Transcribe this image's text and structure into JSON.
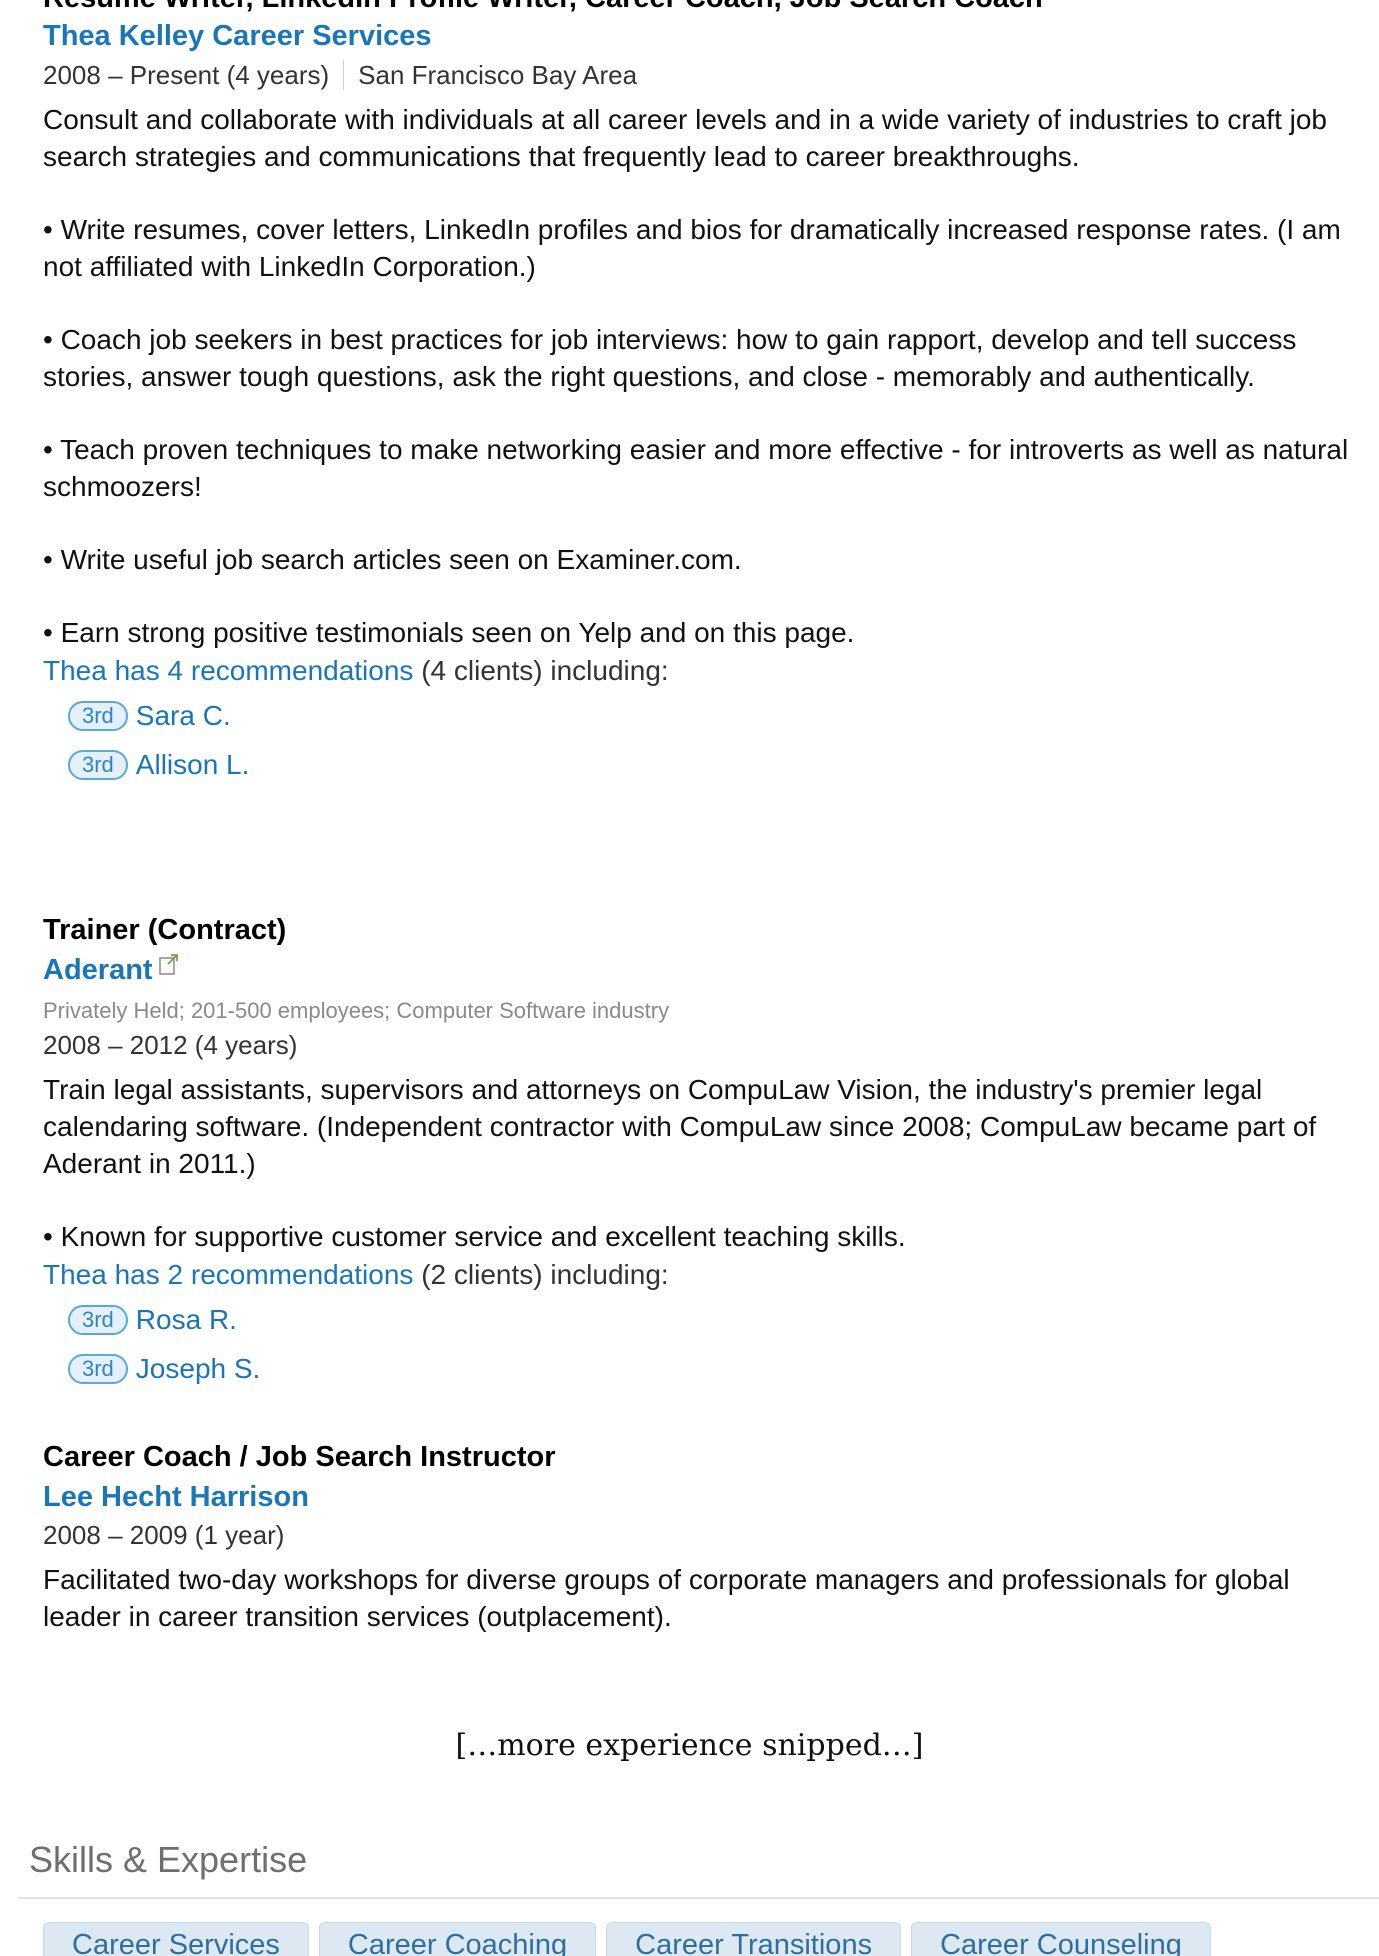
{
  "first_position": {
    "title": "Resume Writer, LinkedIn Profile Writer, Career Coach, Job Search Coach",
    "company": "Thea Kelley Career Services",
    "dates": "2008 – Present (4 years)",
    "location": "San Francisco Bay Area",
    "paragraphs": [
      "Consult and collaborate with individuals at all career levels and in a wide variety of industries to craft job search strategies and communications that frequently lead to career breakthroughs.",
      "• Write resumes, cover letters, LinkedIn profiles and bios for dramatically increased response rates. (I am not affiliated with LinkedIn Corporation.)",
      "• Coach job seekers in best practices for job interviews: how to gain rapport, develop and tell success stories, answer tough questions, ask the right questions, and close - memorably and authentically.",
      "• Teach proven techniques to make networking easier and more effective - for introverts as well as natural schmoozers!",
      "• Write useful job search articles seen on Examiner.com.",
      "• Earn strong positive testimonials seen on Yelp and on this page."
    ],
    "recs_link": "Thea has 4 recommendations",
    "recs_rest": " (4 clients) including:",
    "recommenders": [
      {
        "badge": "3rd",
        "name": "Sara C."
      },
      {
        "badge": "3rd",
        "name": "Allison L."
      }
    ]
  },
  "second_position": {
    "title": "Trainer (Contract)",
    "company": "Aderant",
    "company_info": "Privately Held; 201-500 employees; Computer Software industry",
    "dates": "2008 – 2012 (4 years)",
    "paragraphs": [
      "Train legal assistants, supervisors and attorneys on CompuLaw Vision, the industry's premier legal calendaring software. (Independent contractor with CompuLaw since 2008; CompuLaw became part of Aderant in 2011.)",
      "• Known for supportive customer service and excellent teaching skills."
    ],
    "recs_link": "Thea has 2 recommendations",
    "recs_rest": " (2 clients) including:",
    "recommenders": [
      {
        "badge": "3rd",
        "name": "Rosa R."
      },
      {
        "badge": "3rd",
        "name": "Joseph S."
      }
    ]
  },
  "third_position": {
    "title": "Career Coach / Job Search Instructor",
    "company": "Lee Hecht Harrison",
    "dates": "2008 – 2009 (1 year)",
    "paragraphs": [
      "Facilitated two-day workshops for diverse groups of corporate managers and professionals for global leader in career transition services (outplacement)."
    ]
  },
  "snipped_note": "[…more experience snipped…]",
  "skills": {
    "heading": "Skills & Expertise",
    "tags": [
      "Career Services",
      "Career Coaching",
      "Career Transitions",
      "Career Counseling"
    ]
  },
  "icons": {
    "external_link": "external-link-icon"
  },
  "colors": {
    "link": "#1b76b8",
    "badge_border": "#5aa9d9",
    "skill_tag_bg": "#dde9f2"
  }
}
